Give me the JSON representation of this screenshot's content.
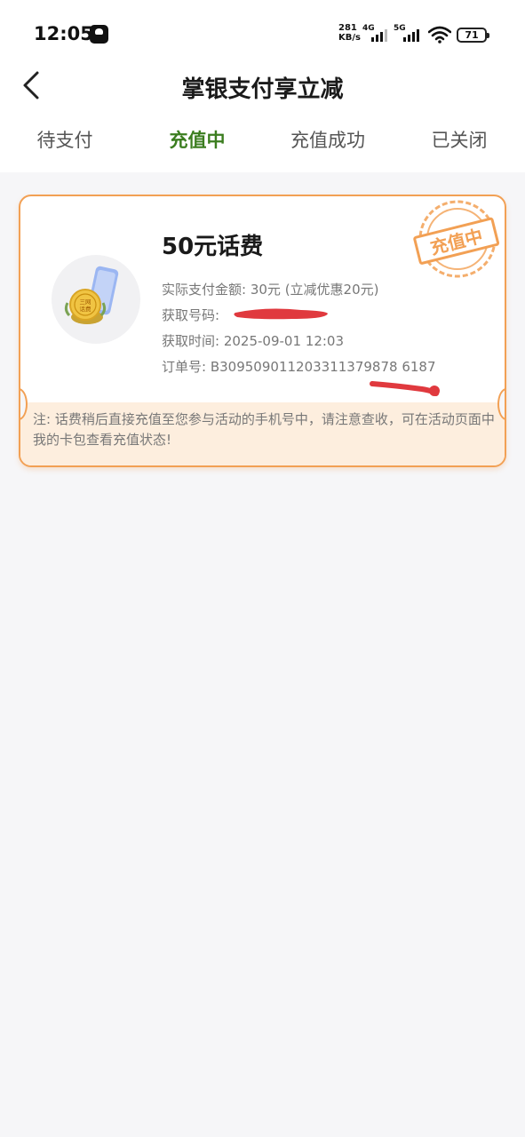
{
  "status_bar": {
    "time": "12:05",
    "speed_value": "281",
    "speed_unit": "KB/s",
    "net1": "4G",
    "net2": "5G",
    "battery": "71"
  },
  "header": {
    "title": "掌银支付享立减"
  },
  "tabs": [
    {
      "label": "待支付",
      "active": false
    },
    {
      "label": "充值中",
      "active": true
    },
    {
      "label": "充值成功",
      "active": false
    },
    {
      "label": "已关闭",
      "active": false
    }
  ],
  "order": {
    "title": "50元话费",
    "paid_label": "实际支付金额:",
    "paid_value": "30元 (立减优惠20元)",
    "phone_label": "获取号码:",
    "time_label": "获取时间:",
    "time_value": "2025-09-01 12:03",
    "order_label": "订单号:",
    "order_value": "B309509011203311379878 6187",
    "stamp_text": "充值中",
    "product_badge": "三网话费",
    "note": "注: 话费稍后直接充值至您参与活动的手机号中，请注意查收，可在活动页面中我的卡包查看充值状态!"
  },
  "colors": {
    "accent_green": "#3b7d1f",
    "card_border": "#f2a054",
    "note_bg": "#fdeede",
    "redaction": "#e0393e"
  }
}
